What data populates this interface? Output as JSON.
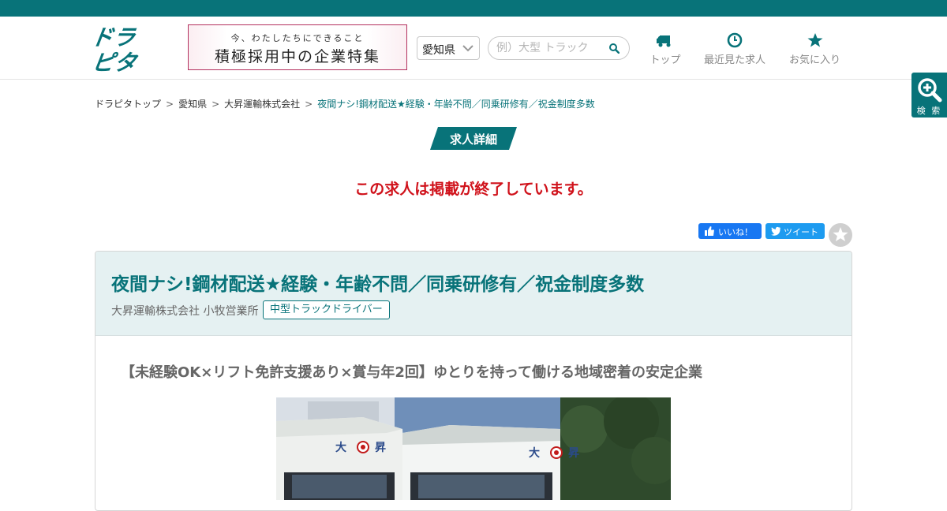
{
  "header": {
    "logo_text": "ドラピタ",
    "banner": {
      "small": "今、わたしたちにできること",
      "main": "積極採用中の企業特集"
    },
    "prefecture": "愛知県",
    "search_placeholder": "例）大型 トラック",
    "nav": [
      {
        "label": "トップ",
        "icon": "truck-icon"
      },
      {
        "label": "最近見た求人",
        "icon": "clock-icon"
      },
      {
        "label": "お気に入り",
        "icon": "star-icon"
      }
    ]
  },
  "side": {
    "zoom_label": "検 索"
  },
  "breadcrumb": [
    "ドラピタトップ",
    "愛知県",
    "大昇運輸株式会社",
    "夜間ナシ!鋼材配送★経験・年齢不問／同乗研修有／祝金制度多数"
  ],
  "section_title": "求人詳細",
  "ended_notice": "この求人は掲載が終了しています。",
  "social": {
    "like": "いいね！",
    "tweet": "ツイート"
  },
  "job": {
    "title": "夜間ナシ!鋼材配送★経験・年齢不問／同乗研修有／祝金制度多数",
    "company": "大昇運輸株式会社 小牧営業所",
    "tag": "中型トラックドライバー",
    "catch": "【未経験OK×リフト免許支援あり×賞与年2回】ゆとりを持って働ける地域密着の安定企業"
  },
  "colors": {
    "brand": "#087379",
    "alert": "#d0121b"
  }
}
